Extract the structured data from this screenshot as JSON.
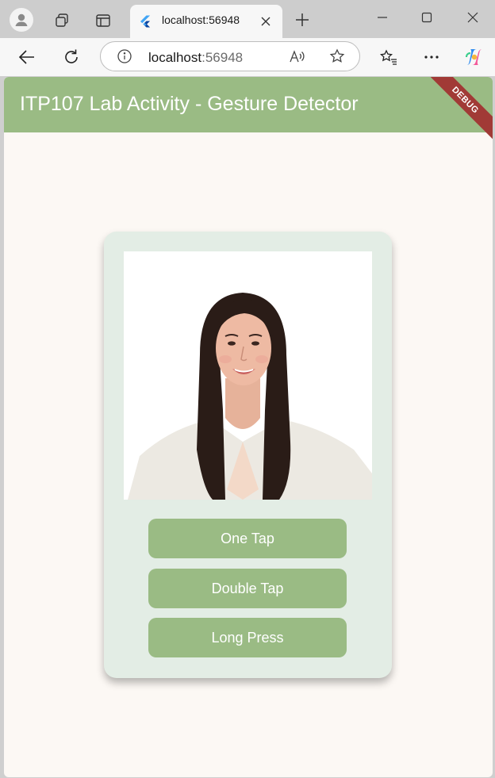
{
  "browser": {
    "tab_title": "localhost:56948",
    "url_host": "localhost",
    "url_port": ":56948"
  },
  "app": {
    "title": "ITP107 Lab Activity - Gesture Detector",
    "debug_banner": "DEBUG",
    "accent_color": "#9abb84",
    "card_color": "#e3ede5",
    "page_background": "#fcf8f4"
  },
  "card": {
    "photo_alt": "Profile photo",
    "buttons": [
      {
        "label": "One Tap"
      },
      {
        "label": "Double Tap"
      },
      {
        "label": "Long Press"
      }
    ]
  }
}
